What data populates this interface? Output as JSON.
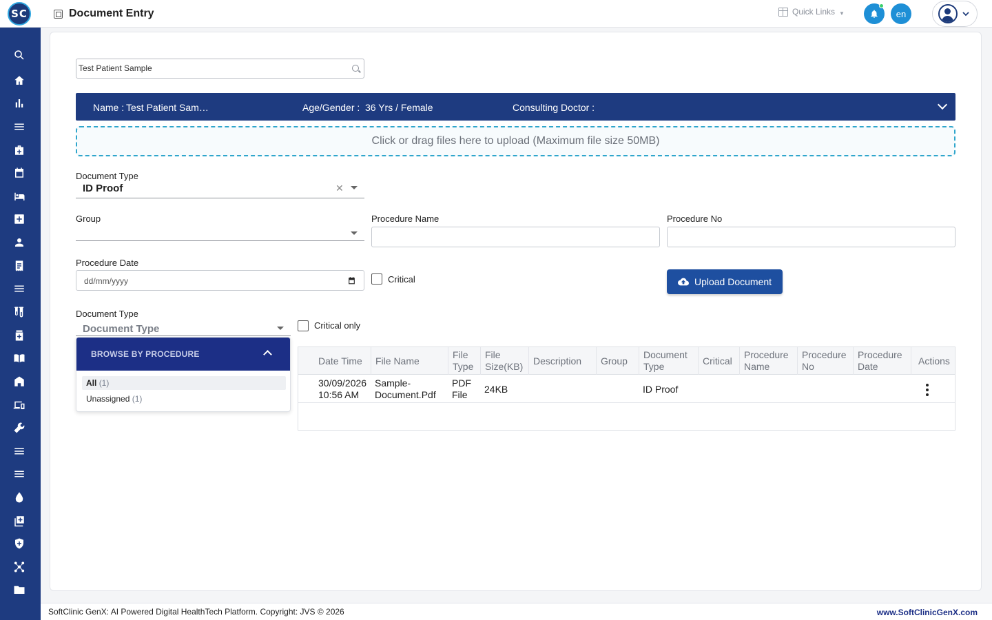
{
  "header": {
    "logo_text": "SC",
    "title": "Document Entry",
    "quick_links": "Quick Links",
    "language": "en"
  },
  "sidebar": {
    "items": [
      "search",
      "home",
      "analytics",
      "menu",
      "medical-bag",
      "calendar",
      "bed",
      "plus-box",
      "person",
      "receipt",
      "list",
      "lab",
      "pharmacy",
      "book",
      "building",
      "devices",
      "wrench",
      "list-alt",
      "list-more",
      "blood-drop",
      "add-library",
      "shield",
      "network",
      "folder"
    ]
  },
  "search": {
    "value": "Test Patient Sample"
  },
  "patient": {
    "name_label": "Name :",
    "name_value": "Test Patient Sam…",
    "age_label": "Age/Gender :",
    "age_value": "36 Yrs / Female",
    "doctor_label": "Consulting Doctor :",
    "doctor_value": ""
  },
  "dropzone": {
    "text": "Click or drag files here to upload (Maximum file size 50MB)"
  },
  "form": {
    "doc_type_label": "Document Type",
    "doc_type_value": "ID Proof",
    "group_label": "Group",
    "procedure_name_label": "Procedure Name",
    "procedure_no_label": "Procedure No",
    "procedure_date_label": "Procedure Date",
    "procedure_date_placeholder": "dd/mm/yyyy",
    "critical_label": "Critical",
    "upload_label": "Upload Document"
  },
  "filter": {
    "doc_type_label": "Document Type",
    "doc_type_placeholder": "Document Type",
    "critical_only_label": "Critical only"
  },
  "browse": {
    "title": "BROWSE BY PROCEDURE",
    "items": [
      {
        "label": "All",
        "count": "(1)"
      },
      {
        "label": "Unassigned",
        "count": "(1)"
      }
    ]
  },
  "table": {
    "columns": [
      "Date Time",
      "File Name",
      "File Type",
      "File Size(KB)",
      "Description",
      "Group",
      "Document Type",
      "Critical",
      "Procedure Name",
      "Procedure No",
      "Procedure Date",
      "Actions"
    ],
    "rows": [
      {
        "date_time": "30/09/2026 10:56 AM",
        "file_name": "Sample-Document.Pdf",
        "file_type": "PDF File",
        "file_size": "24KB",
        "description": "",
        "group": "",
        "document_type": "ID Proof",
        "critical": "",
        "procedure_name": "",
        "procedure_no": "",
        "procedure_date": ""
      }
    ]
  },
  "footer": {
    "copyright": "SoftClinic GenX: AI Powered Digital HealthTech Platform. Copyright: JVS © 2026",
    "website": "www.SoftClinicGenX.com"
  },
  "colors": {
    "brand_navy": "#1e3b80",
    "accent_blue": "#1e8fd6",
    "button_blue": "#1e4fa0",
    "dropzone_border": "#2fa6cc"
  }
}
